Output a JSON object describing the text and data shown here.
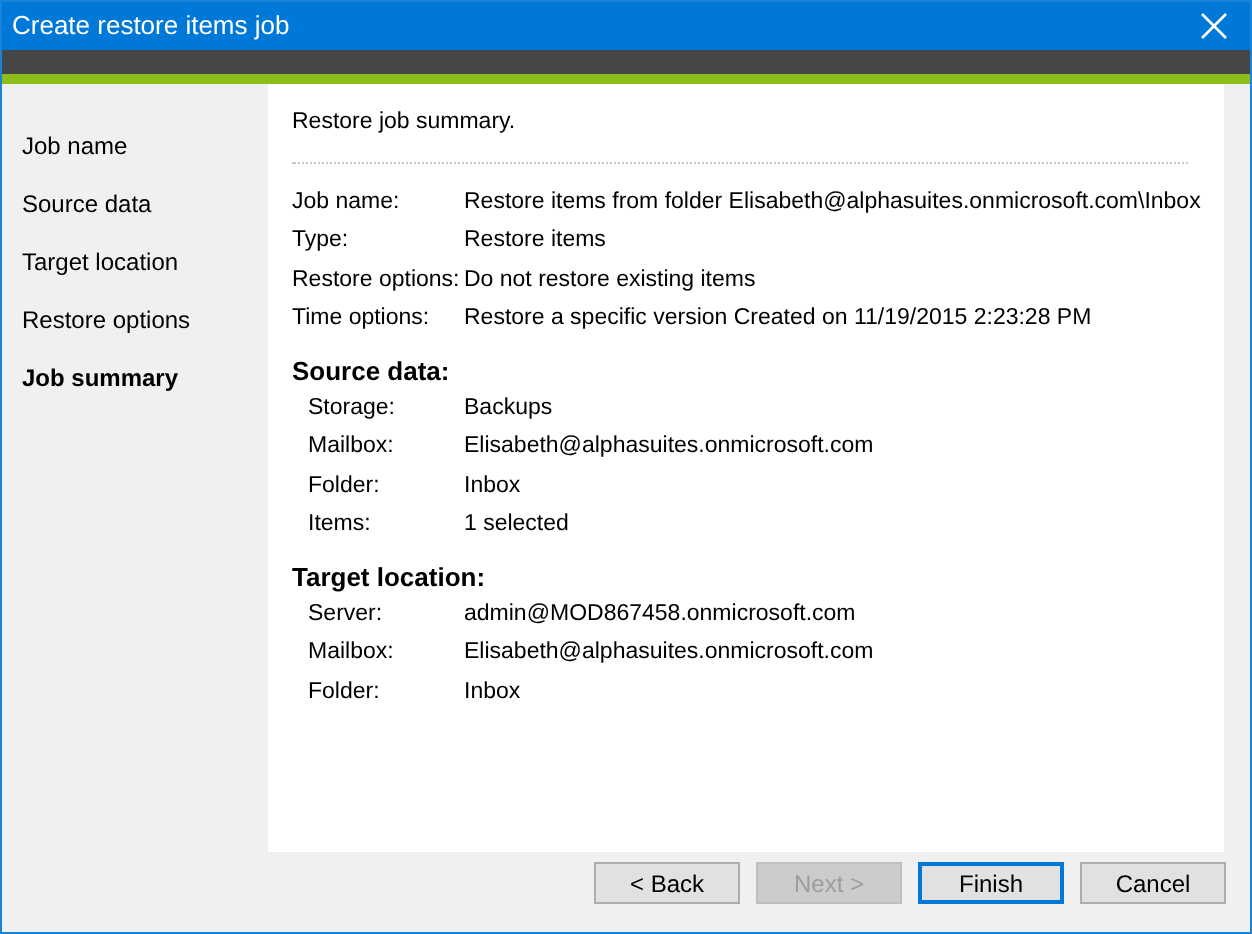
{
  "window": {
    "title": "Create restore items job"
  },
  "steps": [
    {
      "label": "Job name",
      "selected": false
    },
    {
      "label": "Source data",
      "selected": false
    },
    {
      "label": "Target location",
      "selected": false
    },
    {
      "label": "Restore options",
      "selected": false
    },
    {
      "label": "Job summary",
      "selected": true
    }
  ],
  "summary": {
    "heading": "Restore job summary.",
    "rows": [
      {
        "label": "Job name:",
        "value": "Restore items from folder Elisabeth@alphasuites.onmicrosoft.com\\Inbox"
      },
      {
        "label": "Type:",
        "value": "Restore items"
      },
      {
        "label": "Restore options:",
        "value": "Do not restore existing items"
      },
      {
        "label": "Time options:",
        "value": "Restore a specific version Created on 11/19/2015 2:23:28 PM"
      }
    ],
    "sections": [
      {
        "title": "Source data:",
        "rows": [
          {
            "label": "Storage:",
            "value": "Backups"
          },
          {
            "label": "Mailbox:",
            "value": "Elisabeth@alphasuites.onmicrosoft.com"
          },
          {
            "label": "Folder:",
            "value": "Inbox"
          },
          {
            "label": "Items:",
            "value": "1 selected"
          }
        ]
      },
      {
        "title": "Target location:",
        "rows": [
          {
            "label": "Server:",
            "value": "admin@MOD867458.onmicrosoft.com"
          },
          {
            "label": "Mailbox:",
            "value": "Elisabeth@alphasuites.onmicrosoft.com"
          },
          {
            "label": "Folder:",
            "value": "Inbox"
          }
        ]
      }
    ]
  },
  "buttons": [
    {
      "label": "< Back",
      "disabled": false,
      "default": false
    },
    {
      "label": "Next >",
      "disabled": true,
      "default": false
    },
    {
      "label": "Finish",
      "disabled": false,
      "default": true
    },
    {
      "label": "Cancel",
      "disabled": false,
      "default": false
    }
  ]
}
